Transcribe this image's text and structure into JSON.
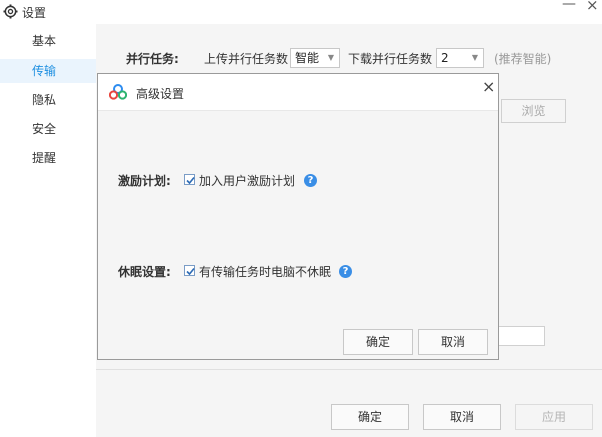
{
  "window": {
    "title": "设置",
    "minimize": "—",
    "close": "×"
  },
  "sidebar": {
    "items": [
      {
        "label": "基本"
      },
      {
        "label": "传输"
      },
      {
        "label": "隐私"
      },
      {
        "label": "安全"
      },
      {
        "label": "提醒"
      }
    ],
    "active_index": 1
  },
  "transfer": {
    "parallel_label": "并行任务:",
    "upload_label": "上传并行任务数",
    "upload_value": "智能",
    "download_label": "下载并行任务数",
    "download_value": "2",
    "hint": "(推荐智能)",
    "browse_label": "浏览"
  },
  "footer": {
    "ok_label": "确定",
    "cancel_label": "取消",
    "apply_label": "应用"
  },
  "dialog": {
    "title": "高级设置",
    "close": "×",
    "incentive": {
      "label": "激励计划:",
      "checkbox_text": "加入用户激励计划",
      "checked": true
    },
    "sleep": {
      "label": "休眠设置:",
      "checkbox_text": "有传输任务时电脑不休眠",
      "checked": true
    },
    "help_glyph": "?",
    "ok_label": "确定",
    "cancel_label": "取消"
  },
  "colors": {
    "accent": "#1e8fe1",
    "help": "#3a8ee6",
    "panel": "#f5f5f5"
  }
}
